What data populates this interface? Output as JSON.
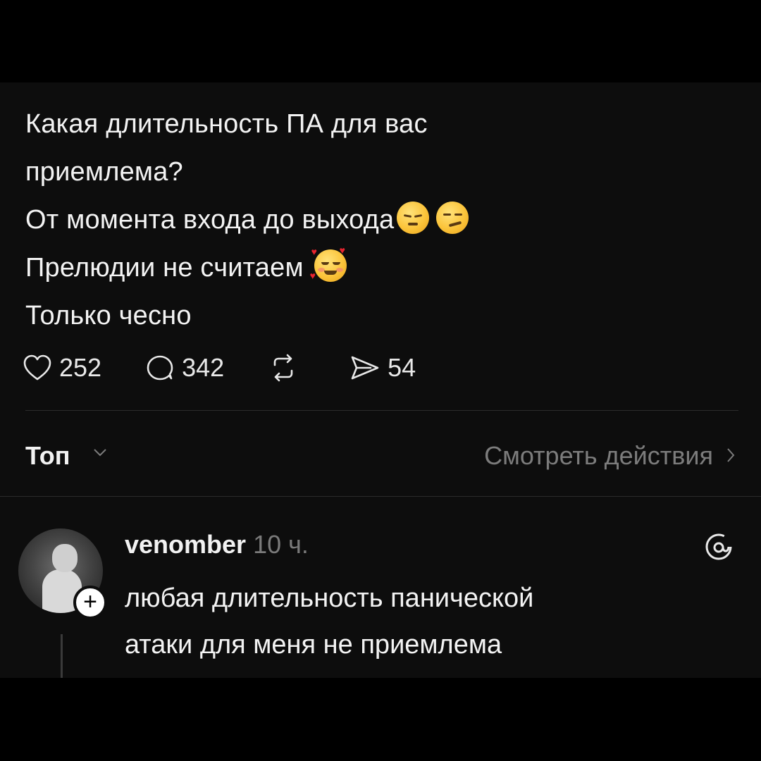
{
  "post": {
    "lines": [
      "Какая длительность ПА для вас",
      "приемлема?",
      "От момента входа до выхода",
      "Прелюдии не считаем",
      "Только чесно"
    ],
    "emojis": [
      "relieved-face",
      "smirking-face",
      "smiling-face-with-hearts"
    ],
    "stats": {
      "likes": "252",
      "comments": "342",
      "shares": "54"
    }
  },
  "sort": {
    "label": "Топ",
    "view_activity": "Смотреть действия"
  },
  "reply": {
    "username": "venomber",
    "time": "10 ч.",
    "lines": [
      "любая длительность панической",
      "атаки для меня не приемлема"
    ]
  },
  "colors": {
    "background": "#0d0d0d",
    "letterbox": "#000000",
    "text": "#f3f3f3",
    "muted": "#7a7a7a",
    "divider": "#2c2c2c"
  }
}
